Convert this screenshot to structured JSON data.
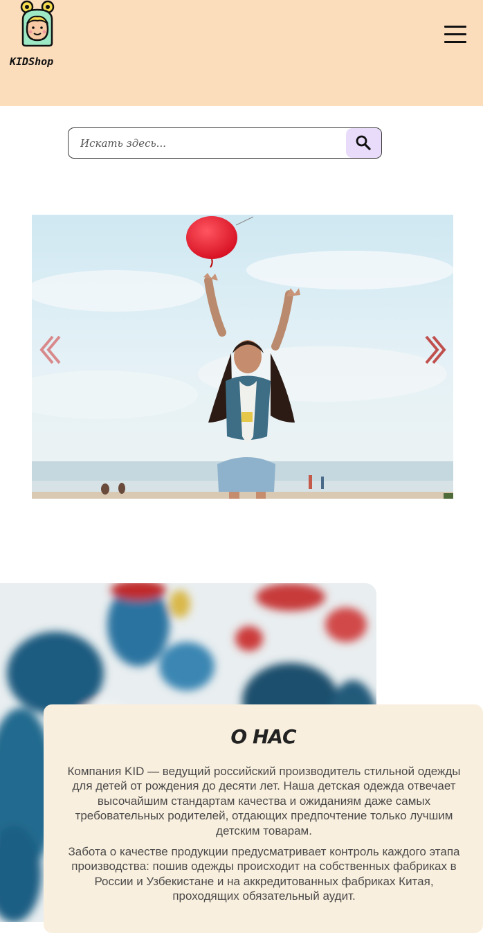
{
  "header": {
    "logo_icon": "girl-avatar-icon",
    "logo_text": "KIDShop",
    "menu_icon": "hamburger-menu-icon",
    "background_color": "#fbddbc"
  },
  "search": {
    "placeholder": "Искать здесь...",
    "value": "",
    "button_icon": "search-icon",
    "button_color": "#e8dcfa"
  },
  "slider": {
    "image": "girl-with-red-balloon-on-beach",
    "prev_icon": "chevron-left-icon",
    "next_icon": "chevron-right-icon",
    "arrow_color": "#c0504d"
  },
  "about": {
    "background_image": "painted-handprints",
    "title": "О НАС",
    "paragraphs": [
      "Компания KID — ведущий российский производитель стильной одежды для детей от рождения до десяти лет. Наша детская одежда отвечает высочайшим стандартам качества и ожиданиям даже самых требовательных родителей, отдающих предпочтение только лучшим детским товарам.",
      "Забота о качестве продукции предусматривает контроль каждого этапа производства: пошив одежды происходит на собственных фабриках в России и Узбекистане и на аккредитованных фабриках Китая, проходящих обязательный аудит."
    ],
    "card_color": "#f9efde"
  }
}
